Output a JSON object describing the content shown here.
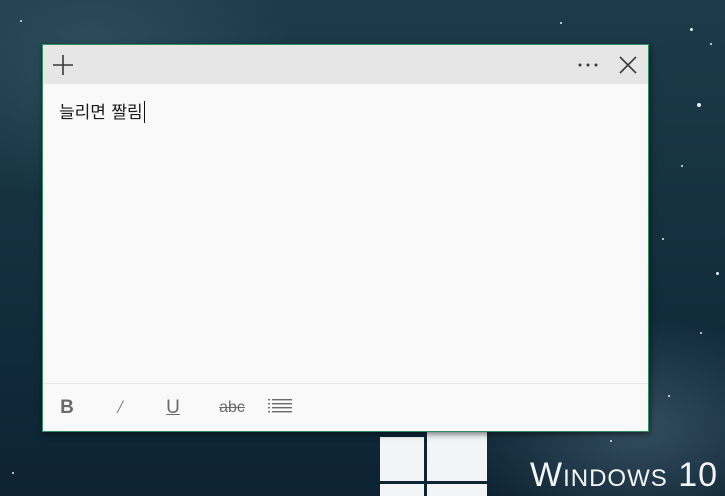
{
  "note": {
    "text": "늘리면 짤림",
    "toolbar": {
      "bold_label": "B",
      "italic_label": "/",
      "underline_label": "U",
      "strikethrough_label": "abc"
    },
    "icons": {
      "add": "plus-icon",
      "more": "ellipsis-icon",
      "close": "close-icon",
      "bullets": "bulleted-list-icon"
    }
  },
  "desktop": {
    "os_brand": "Windows 10"
  },
  "colors": {
    "note_background": "#f9f9f9",
    "titlebar_background": "#e6e6e6",
    "window_border": "#2f8f63",
    "desktop_background": "#163241"
  }
}
